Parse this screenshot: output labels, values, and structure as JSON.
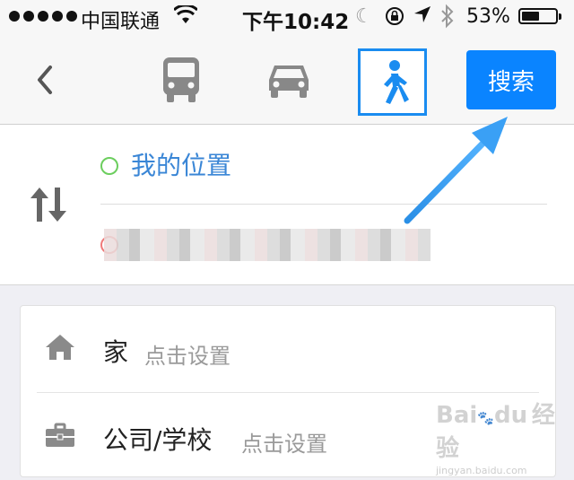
{
  "status_bar": {
    "carrier": "中国联通",
    "time": "下午10:42",
    "battery_percent_text": "53%",
    "battery_level": 0.53,
    "icons": [
      "signal-dots",
      "wifi-icon",
      "moon-icon",
      "orientation-lock-icon",
      "location-arrow-icon",
      "bluetooth-icon",
      "battery-icon"
    ]
  },
  "nav": {
    "back_icon": "chevron-left-icon",
    "modes": [
      "bus-icon",
      "car-icon",
      "walk-icon"
    ],
    "selected_mode": "walk",
    "search_label": "搜索",
    "accent_color": "#0a84ff"
  },
  "route": {
    "origin": "我的位置",
    "destination_blurred": true
  },
  "favorites": [
    {
      "label": "家",
      "hint": "点击设置",
      "icon": "home-icon"
    },
    {
      "label": "公司/学校",
      "hint": "点击设置",
      "icon": "briefcase-icon"
    }
  ],
  "watermark": {
    "brand": "Bai",
    "brand2": "du",
    "jingyan": "经验",
    "url": "jingyan.baidu.com"
  }
}
